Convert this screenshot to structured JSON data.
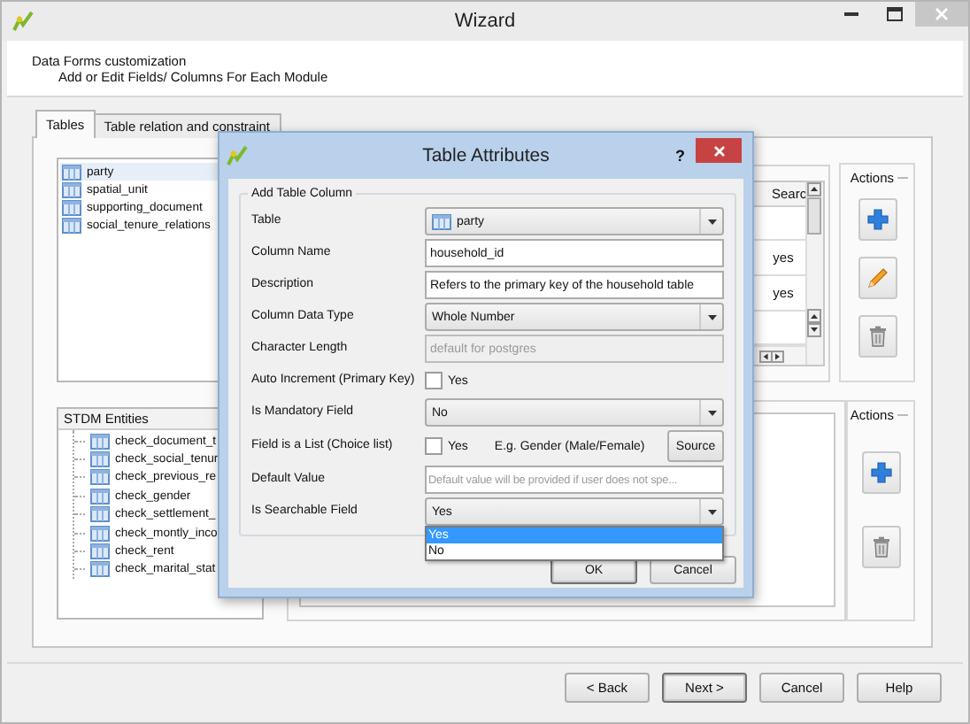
{
  "window": {
    "title": "Wizard"
  },
  "header": {
    "title": "Data Forms customization",
    "subtitle": "Add or Edit Fields/ Columns For Each Module"
  },
  "tabs": [
    {
      "label": "Tables",
      "selected": true
    },
    {
      "label": "Table relation and constraint",
      "selected": false
    }
  ],
  "tables_list": [
    {
      "label": "party",
      "selected": true
    },
    {
      "label": "spatial_unit",
      "selected": false
    },
    {
      "label": "supporting_document",
      "selected": false
    },
    {
      "label": "social_tenure_relations",
      "selected": false
    }
  ],
  "columns_table": {
    "columns": [
      "Searc"
    ],
    "rows": [
      [
        "yes"
      ],
      [
        "yes"
      ]
    ]
  },
  "actions_top": {
    "title": "Actions",
    "buttons": [
      {
        "kind": "add"
      },
      {
        "kind": "edit"
      },
      {
        "kind": "delete"
      }
    ]
  },
  "entities_tree": {
    "header": "STDM Entities",
    "items": [
      {
        "label": "check_document_t"
      },
      {
        "label": "check_social_tenur"
      },
      {
        "label": "check_previous_re"
      },
      {
        "label": "check_gender"
      },
      {
        "label": "check_settlement_"
      },
      {
        "label": "check_montly_inco"
      },
      {
        "label": "check_rent"
      },
      {
        "label": "check_marital_stat"
      }
    ]
  },
  "actions_bottom": {
    "title": "Actions",
    "buttons": [
      {
        "kind": "add"
      },
      {
        "kind": "delete"
      }
    ]
  },
  "buttons": [
    {
      "label": "< Back",
      "default": false
    },
    {
      "label": "Next >",
      "default": true
    },
    {
      "label": "Cancel",
      "default": false
    },
    {
      "label": "Help",
      "default": false
    }
  ],
  "dialog": {
    "title": "Table Attributes",
    "help": "?",
    "group_title": "Add Table Column",
    "fields": [
      {
        "kind": "combo",
        "label": "Table",
        "value": "party"
      },
      {
        "kind": "text",
        "label": "Column Name",
        "value": "household_id"
      },
      {
        "kind": "text",
        "label": "Description",
        "value": "Refers to the primary key of the household table"
      },
      {
        "kind": "combo",
        "label": "Column Data Type",
        "value": "Whole Number"
      },
      {
        "kind": "text",
        "label": "Character Length",
        "placeholder": "default for postgres",
        "disabled": true
      },
      {
        "kind": "checkbox",
        "label": "Auto Increment (Primary Key)",
        "option": "Yes",
        "checked": false
      },
      {
        "kind": "combo",
        "label": "Is Mandatory Field",
        "value": "No"
      },
      {
        "kind": "checkbox",
        "label": "Field is a List (Choice list)",
        "option": "Yes",
        "checked": false,
        "hint": "E.g. Gender (Male/Female)",
        "button": "Source"
      },
      {
        "kind": "text",
        "label": "Default Value",
        "placeholder": "Default value will be provided if user does not spe..."
      },
      {
        "kind": "combo",
        "label": "Is Searchable Field",
        "value": "Yes",
        "open": true,
        "options": [
          {
            "label": "Yes",
            "selected": true
          },
          {
            "label": "No",
            "selected": false
          }
        ]
      }
    ],
    "buttons": [
      {
        "label": "OK",
        "default": true
      },
      {
        "label": "Cancel",
        "default": false
      }
    ]
  }
}
